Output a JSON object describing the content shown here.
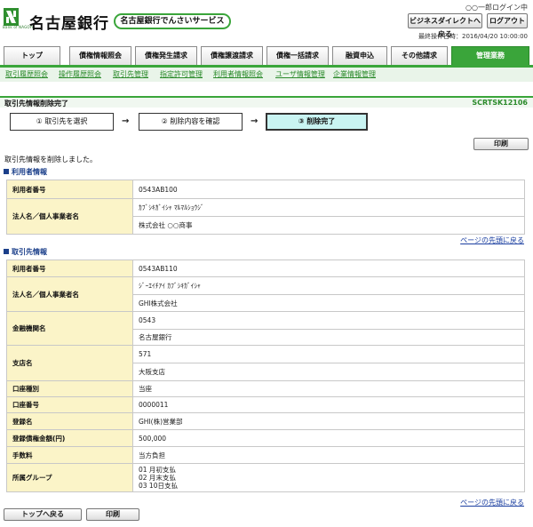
{
  "header": {
    "logo_small_text": "Bank of NAGOYA",
    "bank_name": "名古屋銀行",
    "service_name": "名古屋銀行でんさいサービス",
    "login_user": "○○一郎ログイン中",
    "business_direct_button": "ビジネスダイレクトへ戻る",
    "logout_button": "ログアウト",
    "last_operation": "最終操作日時：2016/04/20 10:00:00"
  },
  "tabs": [
    "トップ",
    "債権情報照会",
    "債権発生請求",
    "債権譲渡請求",
    "債権一括請求",
    "融資申込",
    "その他請求",
    "管理業務"
  ],
  "active_tab": "管理業務",
  "submenu": [
    "取引履歴照会",
    "操作履歴照会",
    "取引先管理",
    "指定許可管理",
    "利用者情報照会",
    "ユーザ情報管理",
    "企業情報管理"
  ],
  "page": {
    "title": "取引先情報削除完了",
    "screen_id": "SCRTSK12106"
  },
  "steps": [
    "① 取引先を選択",
    "② 削除内容を確認",
    "③ 削除完了"
  ],
  "print_button": "印刷",
  "message": "取引先情報を削除しました。",
  "user_info": {
    "heading": "利用者情報",
    "rows": [
      {
        "label": "利用者番号",
        "values": [
          "0543AB100"
        ]
      },
      {
        "label": "法人名／個人事業者名",
        "values": [
          "ｶﾌﾞｼｷｶﾞｲｼｬ ﾏﾙﾏﾙｼｮｳｼﾞ",
          "株式会社 ○○商事"
        ]
      }
    ]
  },
  "partner_info": {
    "heading": "取引先情報",
    "rows": [
      {
        "label": "利用者番号",
        "values": [
          "0543AB110"
        ]
      },
      {
        "label": "法人名／個人事業者名",
        "values": [
          "ｼﾞｰｴｲﾁｱｲ ｶﾌﾞｼｷｶﾞｲｼｬ",
          "GHI株式会社"
        ]
      },
      {
        "label": "金融機関名",
        "values": [
          "0543",
          "名古屋銀行"
        ]
      },
      {
        "label": "支店名",
        "values": [
          "571",
          "大阪支店"
        ]
      },
      {
        "label": "口座種別",
        "values": [
          "当座"
        ]
      },
      {
        "label": "口座番号",
        "values": [
          "0000011"
        ]
      },
      {
        "label": "登録名",
        "values": [
          "GHI(株)営業部"
        ]
      },
      {
        "label": "登録債権金額(円)",
        "values": [
          "500,000"
        ]
      },
      {
        "label": "手数料",
        "values": [
          "当方負担"
        ]
      },
      {
        "label": "所属グループ",
        "values": [
          "01 月初支払",
          "02 月末支払",
          "03 10日支払"
        ]
      }
    ]
  },
  "back_to_top_link": "ページの先頭に戻る",
  "footer": {
    "top_button": "トップへ戻る",
    "print_button": "印刷"
  },
  "colors": {
    "brand_green": "#3aa53a",
    "label_bg": "#fbf4c8",
    "step_done_bg": "#c9f4f2",
    "section_blue": "#1b3f8a"
  }
}
